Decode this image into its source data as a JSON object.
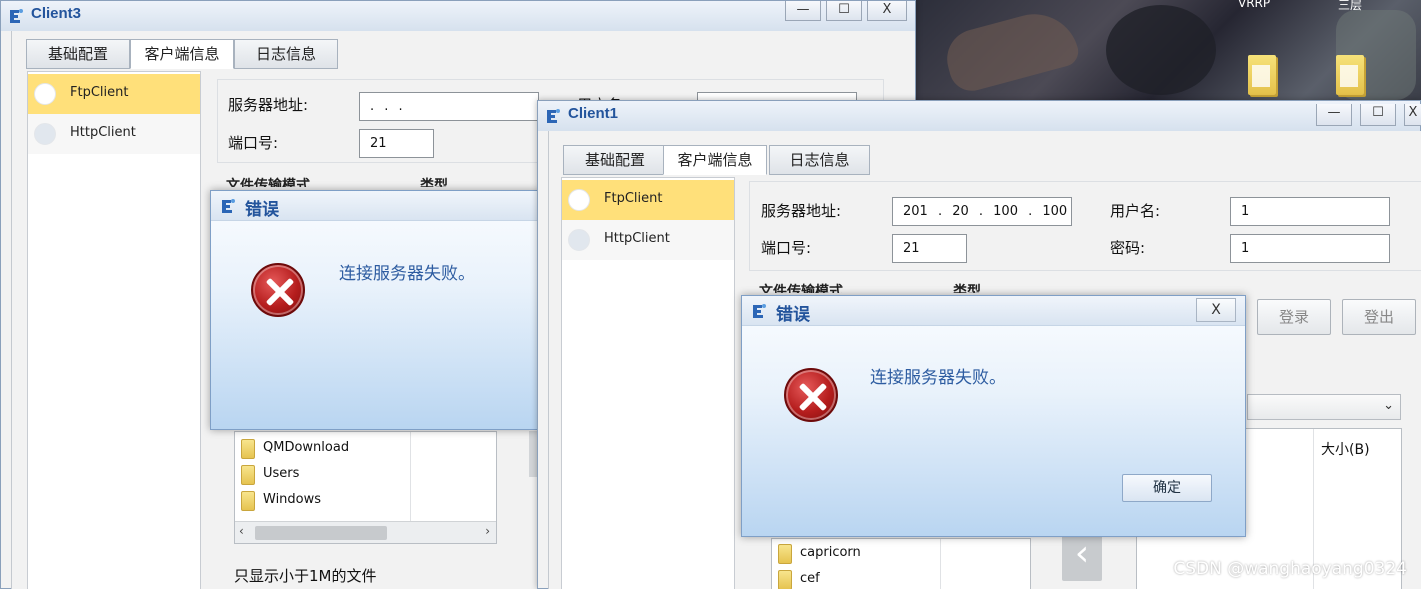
{
  "desktop": {
    "texts": [
      "VRRP",
      "三层"
    ],
    "watermark": "CSDN @wanghaoyang0324"
  },
  "icons": {
    "app": "client-app-icon",
    "error": "error-icon",
    "folder": "folder-icon"
  },
  "colors": {
    "title_text": "#23549c",
    "selected_item": "#ffe07a",
    "error_message": "#2d5ca1",
    "error_red": "#b51d1d"
  },
  "client3": {
    "title": "Client3",
    "controls": {
      "minimize": "—",
      "maximize": "☐",
      "close": "X"
    },
    "tabs": [
      "基础配置",
      "客户端信息",
      "日志信息"
    ],
    "clients": [
      "FtpClient",
      "HttpClient"
    ],
    "form": {
      "server_label": "服务器地址:",
      "server_value": ".    .    .",
      "user_label": "用户名",
      "port_label": "端口号:",
      "port_value": "21"
    },
    "transfer_mode_label": "文件传输模式",
    "type_label": "类型",
    "files": [
      "QMDownload",
      "Users",
      "Windows"
    ],
    "filter_label": "只显示小于1M的文件",
    "error": {
      "title": "错误",
      "message": "连接服务器失败。"
    }
  },
  "client1": {
    "title": "Client1",
    "controls": {
      "minimize": "—",
      "maximize": "☐",
      "close": "X"
    },
    "tabs": [
      "基础配置",
      "客户端信息",
      "日志信息"
    ],
    "clients": [
      "FtpClient",
      "HttpClient"
    ],
    "form": {
      "server_label": "服务器地址:",
      "server_value": "201 . 20 . 100 . 100",
      "user_label": "用户名:",
      "user_value": "1",
      "port_label": "端口号:",
      "port_value": "21",
      "password_label": "密码:",
      "password_value": "1"
    },
    "transfer_mode_label": "文件传输模式",
    "type_label": "类型",
    "login_button": "登录",
    "logout_button": "登出",
    "size_header": "大小(B)",
    "files": [
      "capricorn",
      "cef"
    ],
    "error": {
      "title": "错误",
      "close": "X",
      "message": "连接服务器失败。",
      "ok_button": "确定"
    }
  }
}
